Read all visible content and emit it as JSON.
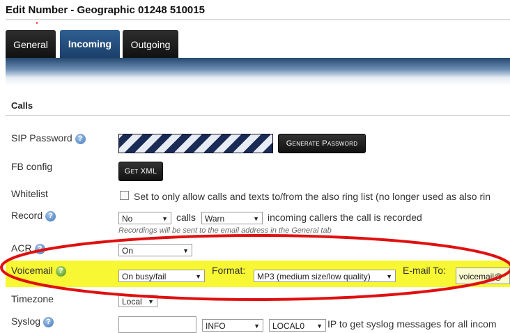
{
  "page": {
    "title": "Edit Number - Geographic 01248 510015"
  },
  "tabs": [
    {
      "label": "General"
    },
    {
      "label": "Incoming"
    },
    {
      "label": "Outgoing"
    }
  ],
  "section": {
    "title": "Calls"
  },
  "sip": {
    "label": "SIP Password",
    "button": "Generate Password"
  },
  "fb": {
    "label": "FB config",
    "button": "Get XML"
  },
  "whitelist": {
    "label": "Whitelist",
    "text": "Set to only allow calls and texts to/from the also ring list (no longer used as also rin"
  },
  "record": {
    "label": "Record",
    "value": "No",
    "calls_text": "calls",
    "warn_value": "Warn",
    "suffix": "incoming callers the call is recorded",
    "hint": "Recordings will be sent to the email address in the General tab"
  },
  "acr": {
    "label": "ACR",
    "value": "On"
  },
  "voicemail": {
    "label": "Voicemail",
    "mode": "On busy/fail",
    "format_label": "Format:",
    "format_value": "MP3 (medium size/low quality)",
    "email_label": "E-mail To:",
    "email_value": "voicemail@"
  },
  "timezone": {
    "label": "Timezone",
    "value": "Local"
  },
  "syslog": {
    "label": "Syslog",
    "level": "INFO",
    "facility": "LOCAL0",
    "suffix": "IP to get syslog messages for all incom"
  },
  "colors": {
    "tab_active": "#2f5f93",
    "highlight": "#f7f733",
    "annotation": "#e01010"
  }
}
